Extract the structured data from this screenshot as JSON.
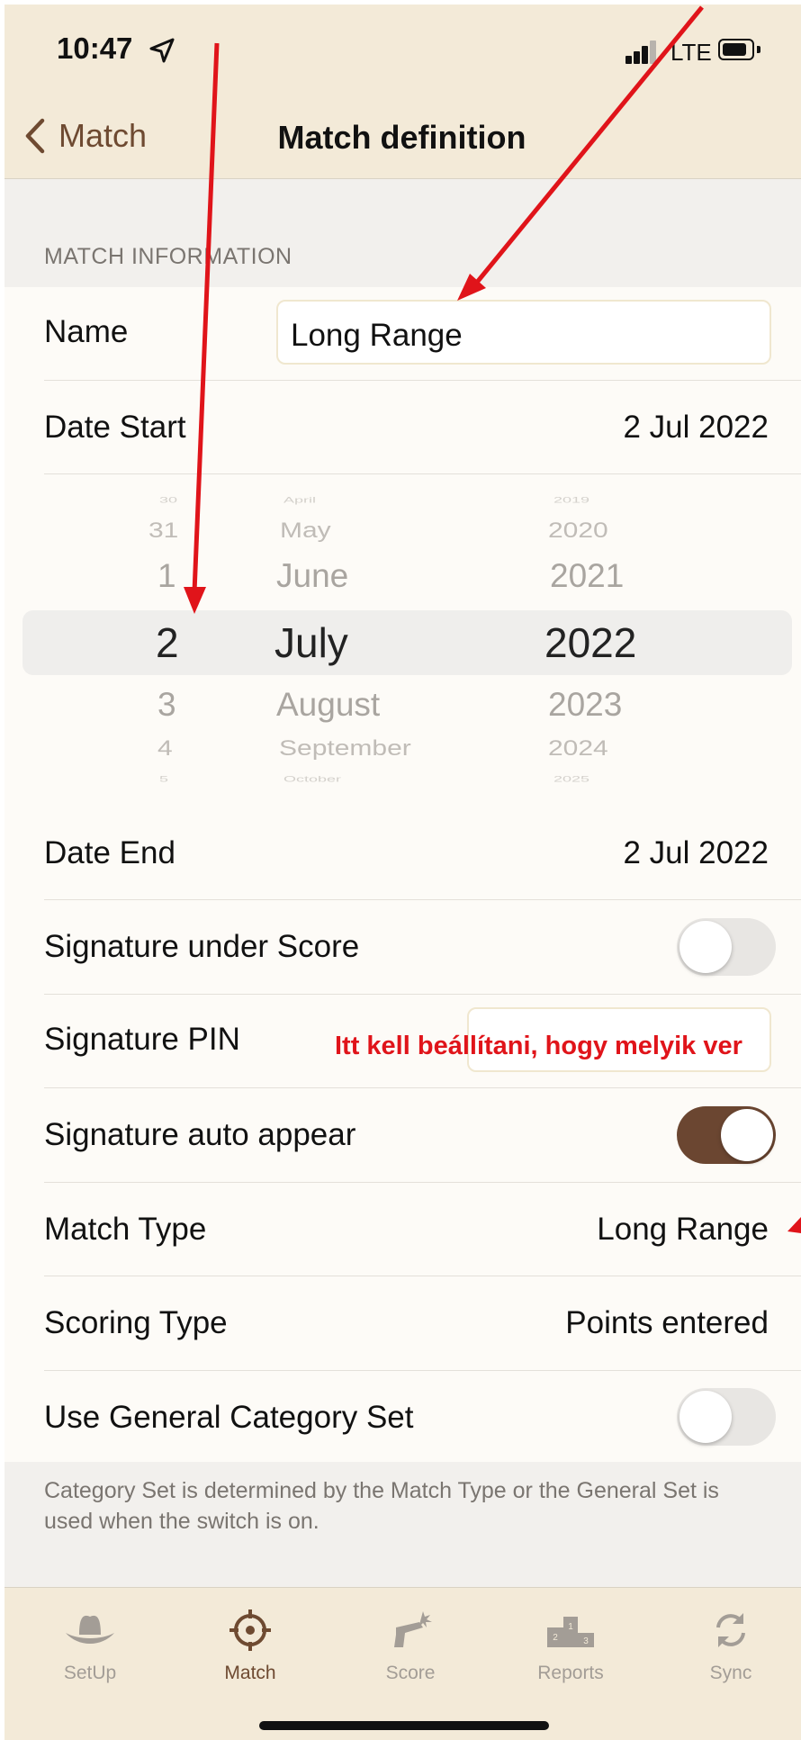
{
  "status_bar": {
    "time": "10:47",
    "network": "LTE"
  },
  "nav": {
    "back_label": "Match",
    "title": "Match definition"
  },
  "section": {
    "header": "MATCH INFORMATION"
  },
  "form": {
    "name_label": "Name",
    "name_value": "Long Range",
    "date_start_label": "Date Start",
    "date_start_value": "2 Jul 2022",
    "date_end_label": "Date End",
    "date_end_value": "2 Jul 2022",
    "signature_under_score_label": "Signature under Score",
    "signature_under_score_on": false,
    "signature_pin_label": "Signature PIN",
    "signature_pin_value": "",
    "signature_auto_appear_label": "Signature auto appear",
    "signature_auto_appear_on": true,
    "match_type_label": "Match Type",
    "match_type_value": "Long Range",
    "scoring_type_label": "Scoring Type",
    "scoring_type_value": "Points entered",
    "general_category_label": "Use General Category Set",
    "general_category_on": false
  },
  "date_picker": {
    "days": [
      "30",
      "31",
      "1",
      "2",
      "3",
      "4",
      "5"
    ],
    "months": [
      "April",
      "May",
      "June",
      "July",
      "August",
      "September",
      "October"
    ],
    "years": [
      "2019",
      "2020",
      "2021",
      "2022",
      "2023",
      "2024",
      "2025"
    ],
    "selected": {
      "day": "2",
      "month": "July",
      "year": "2022"
    }
  },
  "footer_note": "Category Set is determined by the Match Type or the General Set is used when the switch is on.",
  "annotation": {
    "text": "Itt kell beállítani, hogy melyik ver",
    "color": "#e0141a"
  },
  "tabs": [
    {
      "label": "SetUp",
      "icon": "cowboy-hat-icon",
      "active": false
    },
    {
      "label": "Match",
      "icon": "crosshair-icon",
      "active": true
    },
    {
      "label": "Score",
      "icon": "revolver-icon",
      "active": false
    },
    {
      "label": "Reports",
      "icon": "podium-icon",
      "active": false
    },
    {
      "label": "Sync",
      "icon": "sync-icon",
      "active": false
    }
  ],
  "colors": {
    "accent": "#6b4631",
    "bar": "#f3ead8",
    "annotation": "#e0141a"
  }
}
